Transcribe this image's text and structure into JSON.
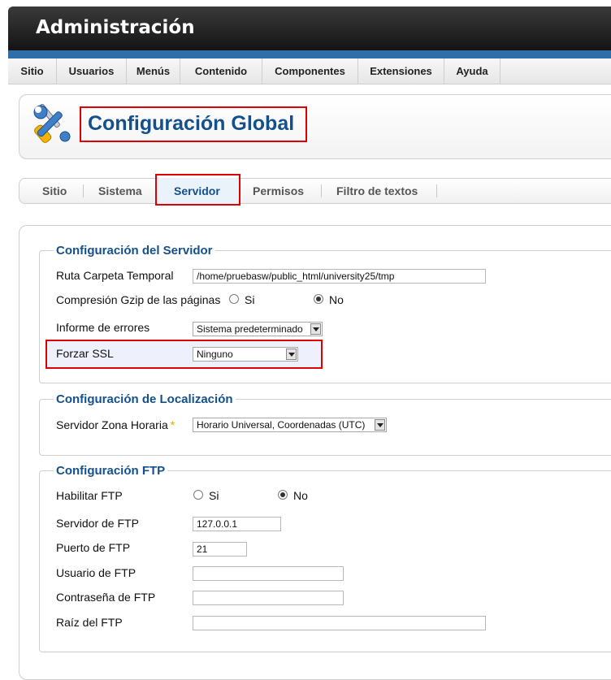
{
  "header": {
    "title": "Administración"
  },
  "menu": {
    "items": [
      "Sitio",
      "Usuarios",
      "Menús",
      "Contenido",
      "Componentes",
      "Extensiones",
      "Ayuda"
    ]
  },
  "page": {
    "title": "Configuración Global"
  },
  "tabs": {
    "items": [
      "Sitio",
      "Sistema",
      "Servidor",
      "Permisos",
      "Filtro de textos"
    ],
    "active": "Servidor"
  },
  "server": {
    "legend": "Configuración del Servidor",
    "tmp_path": {
      "label": "Ruta Carpeta Temporal",
      "value": "/home/pruebasw/public_html/university25/tmp"
    },
    "gzip": {
      "label": "Compresión Gzip de las páginas",
      "yes": "Si",
      "no": "No",
      "selected": "No"
    },
    "error_reporting": {
      "label": "Informe de errores",
      "value": "Sistema predeterminado"
    },
    "force_ssl": {
      "label": "Forzar SSL",
      "value": "Ninguno"
    }
  },
  "locale": {
    "legend": "Configuración de Localización",
    "timezone": {
      "label": "Servidor Zona Horaria",
      "required_mark": "*",
      "value": "Horario Universal, Coordenadas (UTC)"
    }
  },
  "ftp": {
    "legend": "Configuración FTP",
    "enable": {
      "label": "Habilitar FTP",
      "yes": "Si",
      "no": "No",
      "selected": "No"
    },
    "host": {
      "label": "Servidor de FTP",
      "value": "127.0.0.1"
    },
    "port": {
      "label": "Puerto de FTP",
      "value": "21"
    },
    "user": {
      "label": "Usuario de FTP",
      "value": ""
    },
    "password": {
      "label": "Contraseña de FTP",
      "value": ""
    },
    "root": {
      "label": "Raíz del FTP",
      "value": ""
    }
  },
  "colors": {
    "accent": "#15508b",
    "highlight": "#e00000",
    "header_bg": "#1e1e1e"
  }
}
